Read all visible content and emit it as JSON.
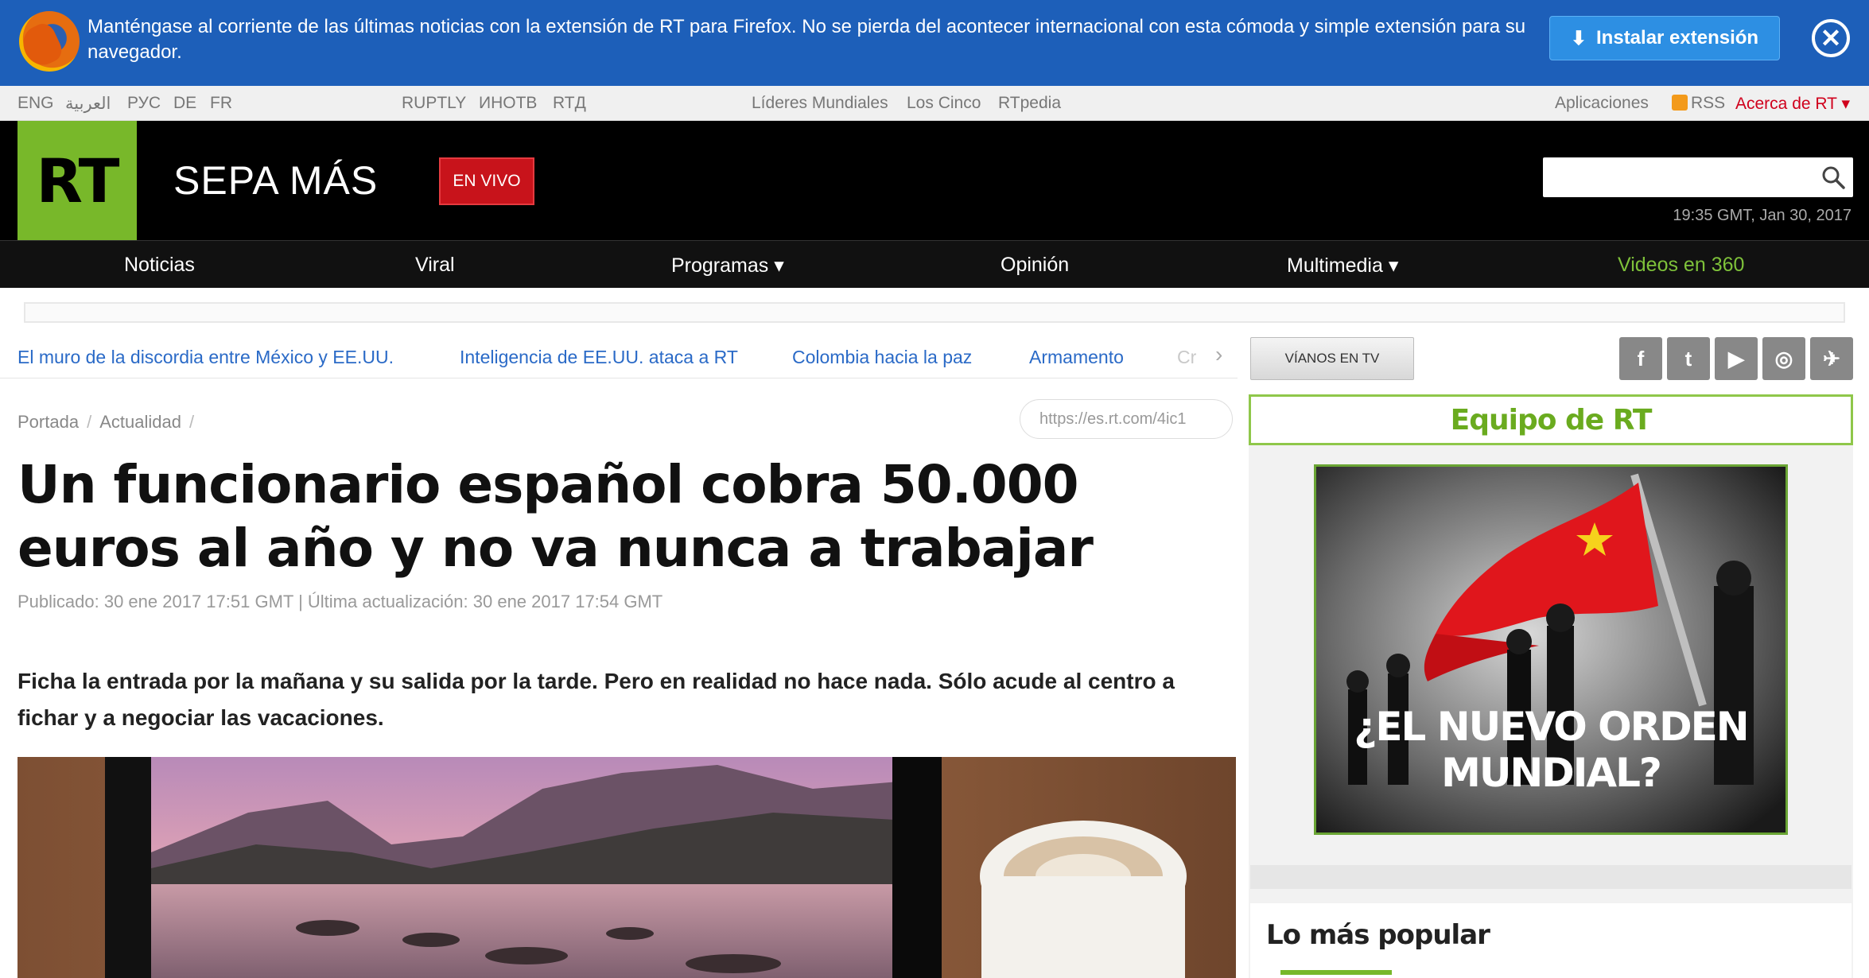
{
  "colors": {
    "rt_green": "#78b82a",
    "banner_blue": "#1d5fb9",
    "live_red": "#c8131b",
    "link_blue": "#2a6ac7"
  },
  "banner": {
    "text": "Manténgase al corriente de las últimas noticias con la extensión de RT para Firefox. No se pierda del acontecer internacional con esta cómoda y simple extensión para su navegador.",
    "install_label": "Instalar extensión",
    "download_icon": "download-icon",
    "close_icon": "close-icon"
  },
  "topstrip": {
    "languages": [
      "ENG",
      "العربية",
      "РУС",
      "DE",
      "FR"
    ],
    "projects": [
      "RUPTLY",
      "ИНОТВ",
      "RTД"
    ],
    "sections": [
      "Líderes Mundiales",
      "Los Cinco",
      "RTpedia"
    ],
    "apps": "Aplicaciones",
    "rss": "RSS",
    "about": "Acerca de RT ▾"
  },
  "header": {
    "logo": "RT",
    "tagline": "SEPA MÁS",
    "live": "EN VIVO",
    "search_placeholder": "",
    "date": "19:35 GMT, Jan 30, 2017"
  },
  "nav": {
    "items": [
      "Noticias",
      "Viral",
      "Programas ▾",
      "Opinión",
      "Multimedia ▾",
      "Videos en 360"
    ]
  },
  "trending": {
    "links": [
      "El muro de la discordia entre México y EE.UU.",
      "Inteligencia de EE.UU. ataca a RT",
      "Colombia hacia la paz",
      "Armamento"
    ],
    "faded": "Cr",
    "arrow": "›"
  },
  "tv_button": "VÍANOS EN TV",
  "social": [
    "f",
    "t",
    "▶",
    "◎",
    "✈"
  ],
  "article": {
    "breadcrumb": [
      "Portada",
      "Actualidad"
    ],
    "short_url": "https://es.rt.com/4ic1",
    "headline": "Un funcionario español cobra 50.000 euros al año y no va nunca a trabajar",
    "published": "Publicado: 30 ene 2017 17:51 GMT | Última actualización: 30 ene 2017 17:54 GMT",
    "lead": "Ficha la entrada por la mañana y su salida por la tarde. Pero en realidad no hace nada. Sólo acude al centro a fichar y a negociar las vacaciones."
  },
  "sidebar": {
    "team": "Equipo de RT",
    "promo_caption": "¿EL NUEVO ORDEN MUNDIAL?",
    "popular_title": "Lo más popular"
  }
}
